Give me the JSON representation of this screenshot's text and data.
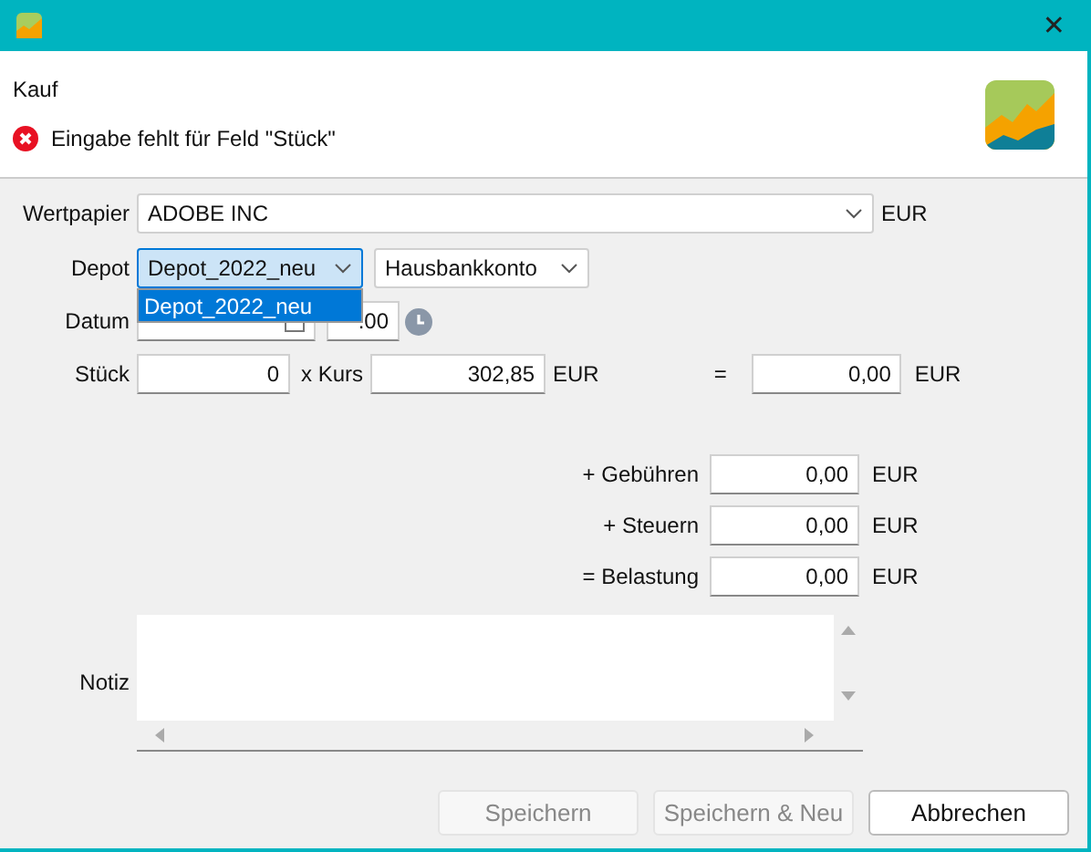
{
  "window": {
    "close": "✕"
  },
  "header": {
    "title": "Kauf",
    "error": "Eingabe fehlt für Feld \"Stück\""
  },
  "security": {
    "label": "Wertpapier",
    "value": "ADOBE INC",
    "currency": "EUR"
  },
  "depot": {
    "label": "Depot",
    "value": "Depot_2022_neu",
    "focused": true,
    "account": "Hausbankkonto",
    "dropdown_open": true,
    "options": [
      {
        "label": "Depot_2022_neu",
        "selected": true
      }
    ]
  },
  "date": {
    "label": "Datum",
    "time": ":00"
  },
  "shares": {
    "label": "Stück",
    "value": "0",
    "price_label": "x Kurs",
    "price": "302,85",
    "price_currency": "EUR",
    "equals": "=",
    "total": "0,00",
    "total_currency": "EUR"
  },
  "fees": [
    {
      "label": "+ Gebühren",
      "value": "0,00",
      "currency": "EUR"
    },
    {
      "label": "+ Steuern",
      "value": "0,00",
      "currency": "EUR"
    },
    {
      "label": "= Belastung",
      "value": "0,00",
      "currency": "EUR"
    }
  ],
  "note": {
    "label": "Notiz"
  },
  "buttons": [
    {
      "label": "Speichern",
      "disabled": true
    },
    {
      "label": "Speichern & Neu",
      "disabled": true
    },
    {
      "label": "Abbrechen",
      "disabled": false
    }
  ]
}
